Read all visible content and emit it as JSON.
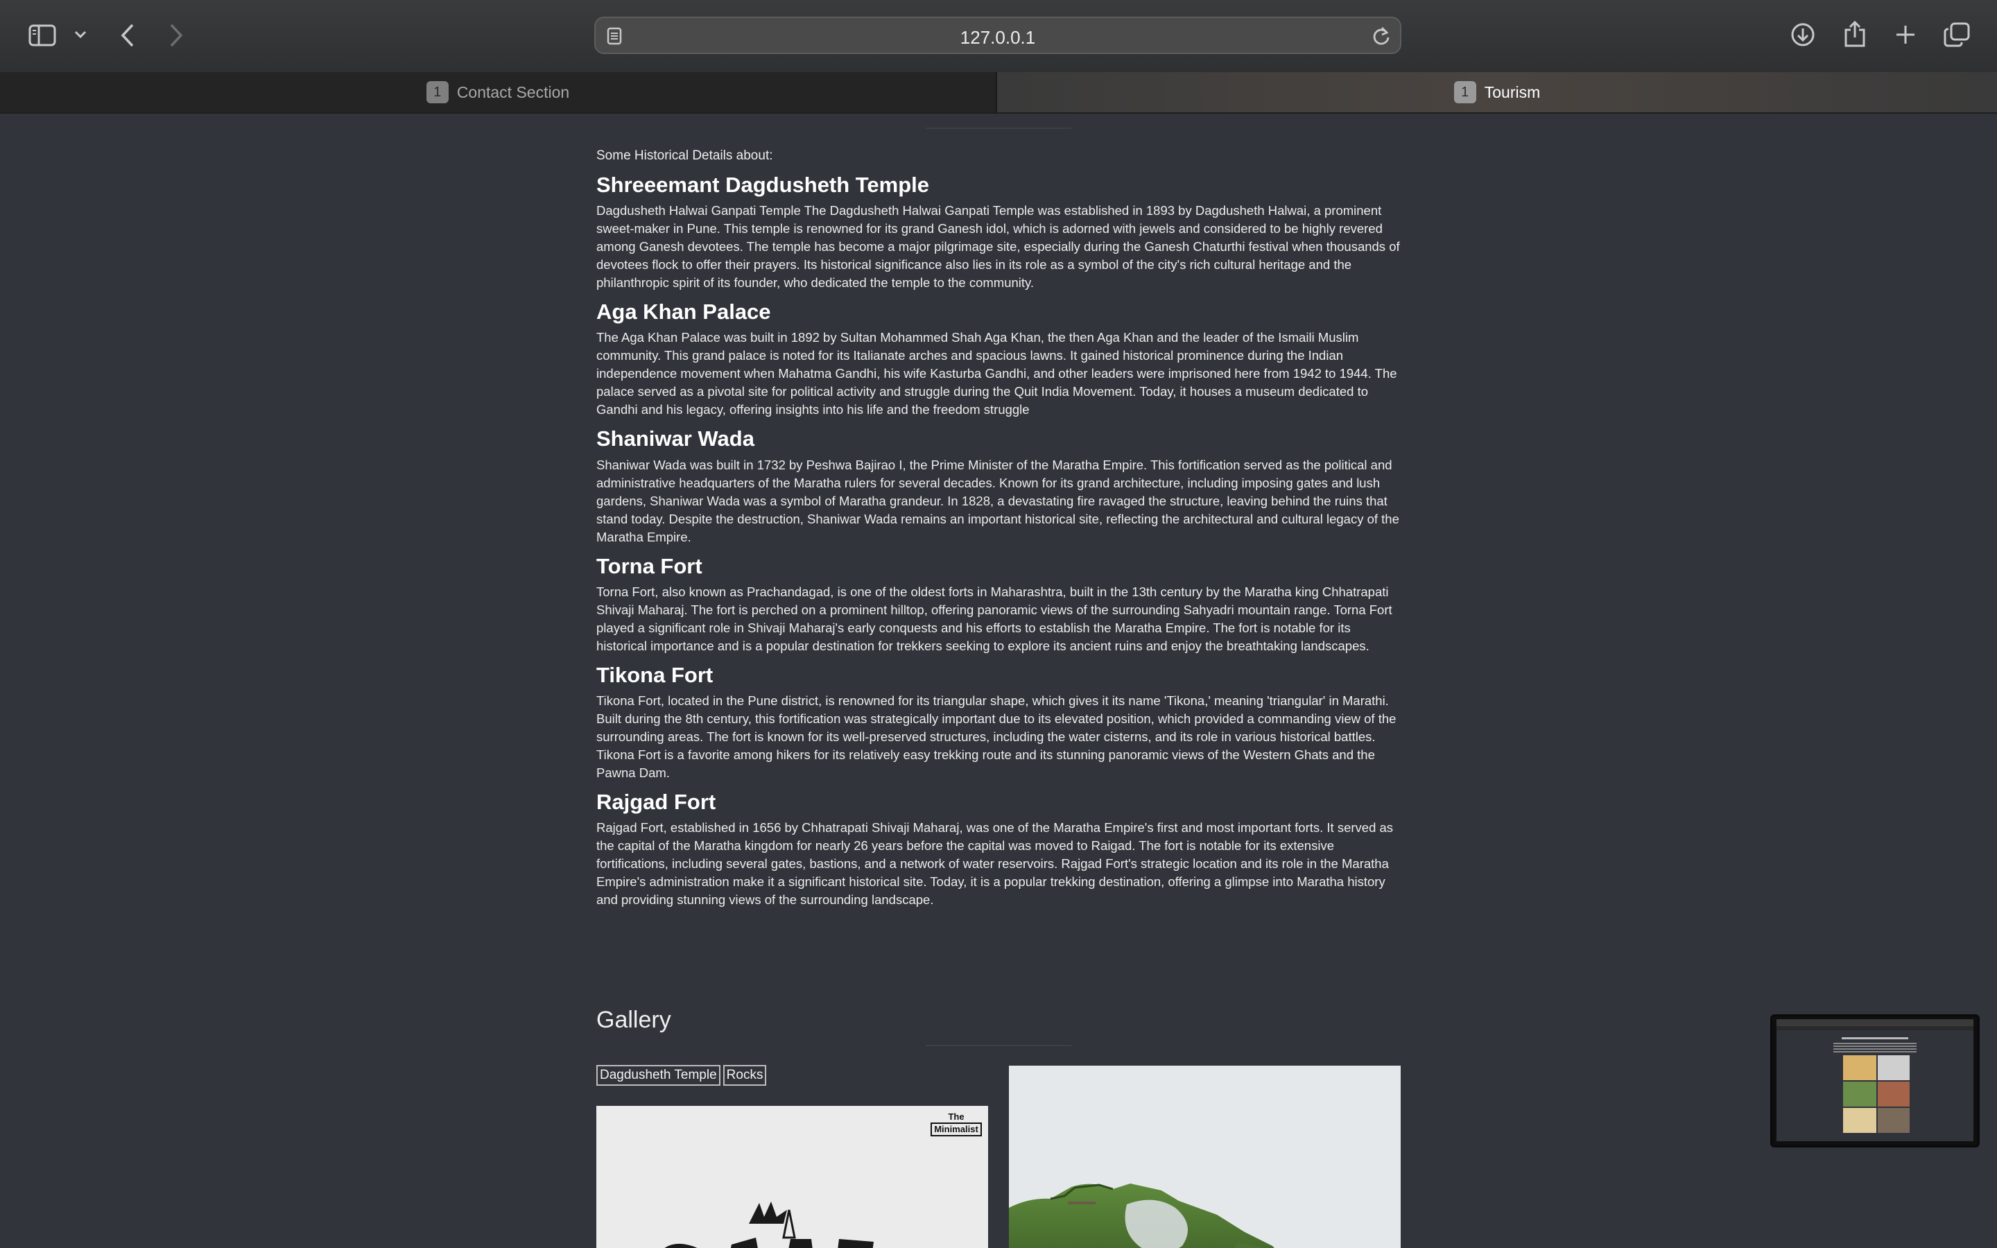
{
  "browser": {
    "url": "127.0.0.1",
    "tabs": [
      {
        "badge": "1",
        "label": "Contact Section",
        "active": false
      },
      {
        "badge": "1",
        "label": "Tourism",
        "active": true
      }
    ]
  },
  "icons": {
    "sidebar": "sidebar-icon",
    "sidebar_menu": "chevron-down-icon",
    "back": "chevron-left-icon",
    "forward": "chevron-right-icon",
    "page": "page-icon",
    "reload": "reload-icon",
    "download": "download-icon",
    "share": "share-icon",
    "new_tab": "plus-icon",
    "tab_overview": "tabs-icon"
  },
  "page": {
    "intro": "Some Historical Details about:",
    "sections": [
      {
        "title": "Shreeemant Dagdusheth Temple",
        "text": "Dagdusheth Halwai Ganpati Temple The Dagdusheth Halwai Ganpati Temple was established in 1893 by Dagdusheth Halwai, a prominent sweet-maker in Pune. This temple is renowned for its grand Ganesh idol, which is adorned with jewels and considered to be highly revered among Ganesh devotees. The temple has become a major pilgrimage site, especially during the Ganesh Chaturthi festival when thousands of devotees flock to offer their prayers. Its historical significance also lies in its role as a symbol of the city's rich cultural heritage and the philanthropic spirit of its founder, who dedicated the temple to the community."
      },
      {
        "title": "Aga Khan Palace",
        "text": "The Aga Khan Palace was built in 1892 by Sultan Mohammed Shah Aga Khan, the then Aga Khan and the leader of the Ismaili Muslim community. This grand palace is noted for its Italianate arches and spacious lawns. It gained historical prominence during the Indian independence movement when Mahatma Gandhi, his wife Kasturba Gandhi, and other leaders were imprisoned here from 1942 to 1944. The palace served as a pivotal site for political activity and struggle during the Quit India Movement. Today, it houses a museum dedicated to Gandhi and his legacy, offering insights into his life and the freedom struggle"
      },
      {
        "title": "Shaniwar Wada",
        "text": "Shaniwar Wada was built in 1732 by Peshwa Bajirao I, the Prime Minister of the Maratha Empire. This fortification served as the political and administrative headquarters of the Maratha rulers for several decades. Known for its grand architecture, including imposing gates and lush gardens, Shaniwar Wada was a symbol of Maratha grandeur. In 1828, a devastating fire ravaged the structure, leaving behind the ruins that stand today. Despite the destruction, Shaniwar Wada remains an important historical site, reflecting the architectural and cultural legacy of the Maratha Empire."
      },
      {
        "title": "Torna Fort",
        "text": "Torna Fort, also known as Prachandagad, is one of the oldest forts in Maharashtra, built in the 13th century by the Maratha king Chhatrapati Shivaji Maharaj. The fort is perched on a prominent hilltop, offering panoramic views of the surrounding Sahyadri mountain range. Torna Fort played a significant role in Shivaji Maharaj's early conquests and his efforts to establish the Maratha Empire. The fort is notable for its historical importance and is a popular destination for trekkers seeking to explore its ancient ruins and enjoy the breathtaking landscapes."
      },
      {
        "title": "Tikona Fort",
        "text": "Tikona Fort, located in the Pune district, is renowned for its triangular shape, which gives it its name 'Tikona,' meaning 'triangular' in Marathi. Built during the 8th century, this fortification was strategically important due to its elevated position, which provided a commanding view of the surrounding areas. The fort is known for its well-preserved structures, including the water cisterns, and its role in various historical battles. Tikona Fort is a favorite among hikers for its relatively easy trekking route and its stunning panoramic views of the Western Ghats and the Pawna Dam."
      },
      {
        "title": "Rajgad Fort",
        "text": "Rajgad Fort, established in 1656 by Chhatrapati Shivaji Maharaj, was one of the Maratha Empire's first and most important forts. It served as the capital of the Maratha kingdom for nearly 26 years before the capital was moved to Raigad. The fort is notable for its extensive fortifications, including several gates, bastions, and a network of water reservoirs. Rajgad Fort's strategic location and its role in the Maratha Empire's administration make it a significant historical site. Today, it is a popular trekking destination, offering a glimpse into Maratha history and providing stunning views of the surrounding landscape."
      }
    ],
    "gallery": {
      "title": "Gallery",
      "filters": [
        "Dagdusheth Temple",
        "Rocks"
      ],
      "card1_brand_top": "The",
      "card1_brand_bottom": "Minimalist"
    }
  }
}
